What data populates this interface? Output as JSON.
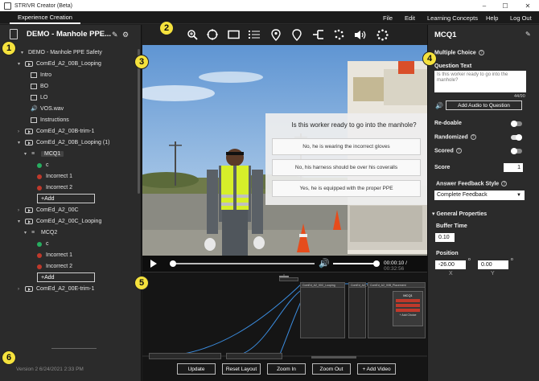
{
  "window": {
    "title": "STRIVR Creator (Beta)",
    "minimize": "–",
    "maximize": "☐",
    "close": "✕"
  },
  "menubar": {
    "active_tab": "Experience Creation",
    "items": [
      "File",
      "Edit",
      "Learning Concepts",
      "Help",
      "Log Out"
    ]
  },
  "project": {
    "title": "DEMO - Manhole PPE..."
  },
  "tree": {
    "root": "DEMO - Manhole PPE Safety",
    "video1": "ComEd_A2_00B_Looping",
    "video1_children": [
      "Intro",
      "BO",
      "LO",
      "VOS.wav",
      "Instructions"
    ],
    "video2": "ComEd_A2_00B-trim-1",
    "video3": "ComEd_A2_00B_Looping (1)",
    "mcq1": "MCQ1",
    "mcq1_answers": [
      "c",
      "Incorrect 1",
      "Incorrect 2"
    ],
    "add_label": "+Add",
    "video4": "ComEd_A2_00C",
    "video5": "ComEd_A2_00C_Looping",
    "mcq2": "MCQ2",
    "mcq2_answers": [
      "c",
      "Incorrect 1",
      "Incorrect 2"
    ],
    "video6": "ComEd_A2_00E-trim-1"
  },
  "version": "Version 2   6/24/2021 2:33 PM",
  "toolbar": {
    "icons": [
      "zoom-icon",
      "target-icon",
      "rectangle-icon",
      "list-icon",
      "pin-icon",
      "pin-outline-icon",
      "branch-icon",
      "dots-icon",
      "audio-icon",
      "spinner-icon"
    ]
  },
  "video": {
    "question": "Is this worker ready to go into the manhole?",
    "options": [
      "No, he is wearing the incorrect gloves",
      "No, his harness should be over his coveralls",
      "Yes, he is equipped with the proper PPE"
    ],
    "current_time": "00:00:10",
    "duration": "00:32:56",
    "progress": 0.02,
    "volume": 1.0
  },
  "timeline": {
    "buttons": [
      "Update",
      "Reset Layout",
      "Zoom In",
      "Zoom Out",
      "+ Add Video"
    ],
    "nodes": [
      "ComEd_A2_00C_Looping",
      "ComEd_A2_00C",
      "ComEd_A2_00B_Placement",
      "MCQ1",
      "+ Add Choice"
    ]
  },
  "inspector": {
    "title": "MCQ1",
    "type_label": "Multiple Choice",
    "question_text_label": "Question Text",
    "question_text": "Is this worker ready to go into the manhole?",
    "char_count": "44/90",
    "audio_button": "Add Audio to Question",
    "redoable_label": "Re-doable",
    "redoable": false,
    "randomized_label": "Randomized",
    "randomized": true,
    "scored_label": "Scored",
    "scored": false,
    "score_label": "Score",
    "score": "1",
    "feedback_style_label": "Answer Feedback Style",
    "feedback_style": "Complete Feedback",
    "general_properties": "General Properties",
    "buffer_time_label": "Buffer Time",
    "buffer_time": "0.10",
    "position_label": "Position",
    "position_x": "-26.00",
    "position_y": "0.00",
    "x_label": "X",
    "y_label": "Y",
    "degree": "o"
  },
  "callouts": [
    "1",
    "2",
    "3",
    "4",
    "5",
    "6"
  ],
  "colors": {
    "callout": "#f5e23d",
    "correct": "#27ae60",
    "incorrect": "#c0392b"
  }
}
